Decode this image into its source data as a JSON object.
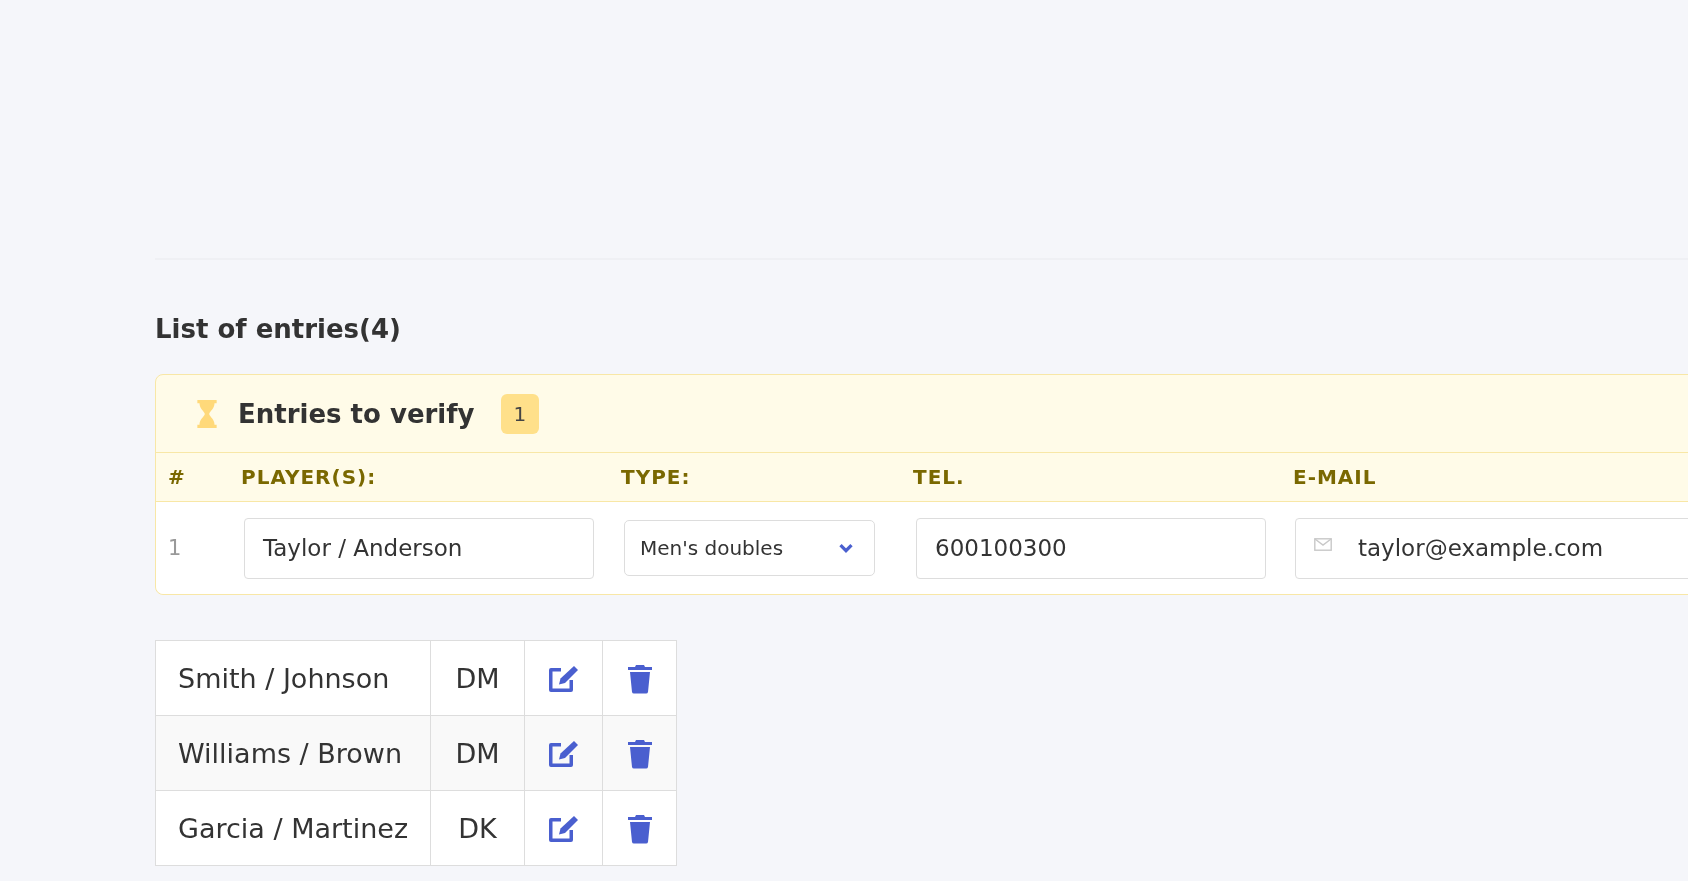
{
  "title": "List of entries(4)",
  "pending": {
    "title": "Entries to verify",
    "count": "1",
    "columns": [
      "#",
      "PLAYER(S):",
      "TYPE:",
      "TEL.",
      "E-MAIL"
    ],
    "rows": [
      {
        "number": "1",
        "players": "Taylor / Anderson",
        "type": "Men's doubles",
        "tel": "600100300",
        "email": "taylor@example.com"
      }
    ]
  },
  "entries": [
    {
      "players": "Smith / Johnson",
      "type": "DM"
    },
    {
      "players": "Williams / Brown",
      "type": "DM"
    },
    {
      "players": "Garcia / Martinez",
      "type": "DK"
    }
  ]
}
